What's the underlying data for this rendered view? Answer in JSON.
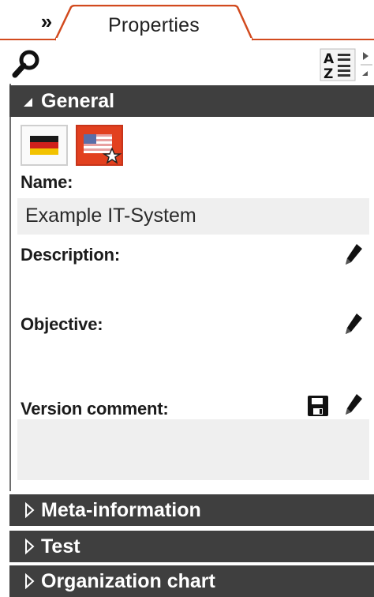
{
  "tab": {
    "collapse_glyph": "»",
    "label": "Properties"
  },
  "toolbar": {
    "search_icon": "search-icon",
    "sort_icon": "sort-az-icon"
  },
  "sections": {
    "general": "General",
    "meta": "Meta-information",
    "test": "Test",
    "org": "Organization chart"
  },
  "languages": [
    {
      "name": "german-flag",
      "selected": false
    },
    {
      "name": "us-flag",
      "selected": true
    }
  ],
  "fields": {
    "name_label": "Name:",
    "name_value": "Example IT-System",
    "description_label": "Description:",
    "objective_label": "Objective:",
    "version_comment_label": "Version comment:"
  },
  "colors": {
    "accent": "#d24a1e",
    "header_bg": "#3f3f3f",
    "field_bg": "#efefef"
  }
}
